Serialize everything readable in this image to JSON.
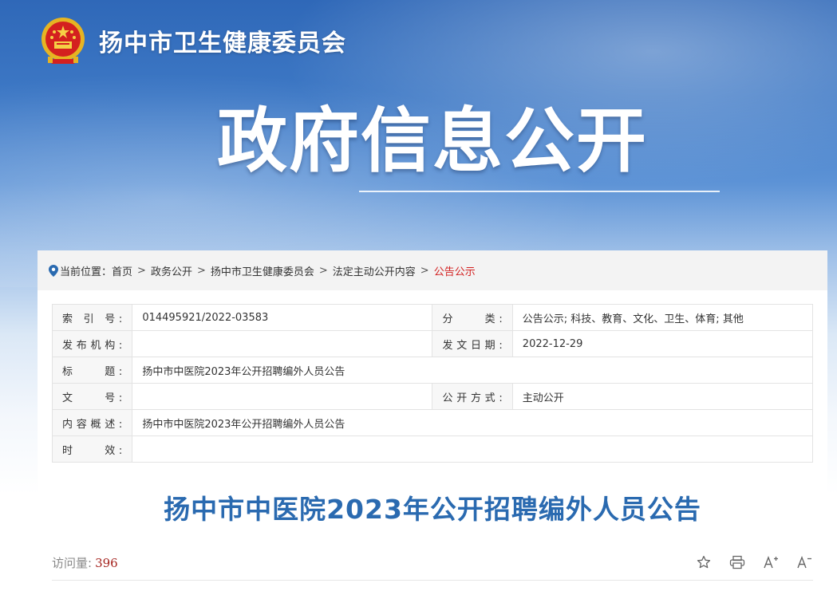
{
  "header": {
    "site_title": "扬中市卫生健康委员会"
  },
  "banner": {
    "title": "政府信息公开"
  },
  "breadcrumb": {
    "prefix": "当前位置：",
    "items": [
      "首页",
      "政务公开",
      "扬中市卫生健康委员会",
      "法定主动公开内容"
    ],
    "current": "公告公示",
    "separator": ">"
  },
  "meta": {
    "index_label": "索 引 号:",
    "index_value": "014495921/2022-03583",
    "category_label": "分　　类:",
    "category_value": "公告公示;  科技、教育、文化、卫生、体育;  其他",
    "publisher_label": "发布机构:",
    "publisher_value": "",
    "date_label": "发文日期:",
    "date_value": "2022-12-29",
    "title_label": "标　　题:",
    "title_value": "扬中市中医院2023年公开招聘编外人员公告",
    "docno_label": "文　　号:",
    "docno_value": "",
    "method_label": "公开方式:",
    "method_value": "主动公开",
    "summary_label": "内容概述:",
    "summary_value": "扬中市中医院2023年公开招聘编外人员公告",
    "validity_label": "时　　效:",
    "validity_value": ""
  },
  "article": {
    "title": "扬中市中医院2023年公开招聘编外人员公告",
    "visits_label": "访问量:",
    "visits_count": "396"
  },
  "colors": {
    "accent_blue": "#2a6ab0",
    "current_red": "#d21f1f",
    "visit_red": "#a5241f"
  },
  "icons": [
    "national-emblem-icon",
    "location-pin-icon",
    "star-icon",
    "print-icon",
    "font-increase-icon",
    "font-decrease-icon"
  ]
}
